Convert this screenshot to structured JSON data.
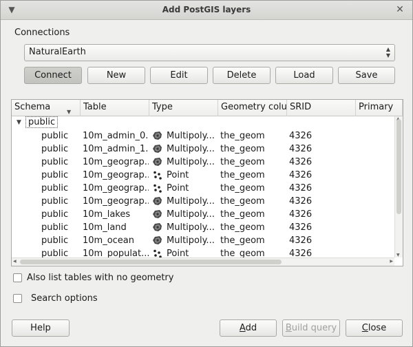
{
  "window": {
    "title": "Add PostGIS layers"
  },
  "connections": {
    "label": "Connections",
    "selected": "NaturalEarth",
    "buttons": {
      "connect": "Connect",
      "new": "New",
      "edit": "Edit",
      "delete": "Delete",
      "load": "Load",
      "save": "Save"
    }
  },
  "table": {
    "columns": [
      "Schema",
      "Table",
      "Type",
      "Geometry colur",
      "SRID",
      "Primary"
    ],
    "schema_node": "public",
    "rows": [
      {
        "schema": "public",
        "table": "10m_admin_0...",
        "type": "Multipoly...",
        "geom_icon": "polygon-icon",
        "geometry": "the_geom",
        "srid": "4326"
      },
      {
        "schema": "public",
        "table": "10m_admin_1...",
        "type": "Multipoly...",
        "geom_icon": "polygon-icon",
        "geometry": "the_geom",
        "srid": "4326"
      },
      {
        "schema": "public",
        "table": "10m_geograp...",
        "type": "Multipoly...",
        "geom_icon": "polygon-icon",
        "geometry": "the_geom",
        "srid": "4326"
      },
      {
        "schema": "public",
        "table": "10m_geograp...",
        "type": "Point",
        "geom_icon": "point-icon",
        "geometry": "the_geom",
        "srid": "4326"
      },
      {
        "schema": "public",
        "table": "10m_geograp...",
        "type": "Point",
        "geom_icon": "point-icon",
        "geometry": "the_geom",
        "srid": "4326"
      },
      {
        "schema": "public",
        "table": "10m_geograp...",
        "type": "Multipoly...",
        "geom_icon": "polygon-icon",
        "geometry": "the_geom",
        "srid": "4326"
      },
      {
        "schema": "public",
        "table": "10m_lakes",
        "type": "Multipoly...",
        "geom_icon": "polygon-icon",
        "geometry": "the_geom",
        "srid": "4326"
      },
      {
        "schema": "public",
        "table": "10m_land",
        "type": "Multipoly...",
        "geom_icon": "polygon-icon",
        "geometry": "the_geom",
        "srid": "4326"
      },
      {
        "schema": "public",
        "table": "10m_ocean",
        "type": "Multipoly...",
        "geom_icon": "polygon-icon",
        "geometry": "the_geom",
        "srid": "4326"
      },
      {
        "schema": "public",
        "table": "10m_populat...",
        "type": "Point",
        "geom_icon": "point-icon",
        "geometry": "the_geom",
        "srid": "4326"
      }
    ]
  },
  "options": {
    "list_no_geometry": "Also list tables with no geometry",
    "search_options": "Search options"
  },
  "footer": {
    "help": "Help",
    "add_prefix": "",
    "add_mnemonic": "A",
    "add_rest": "dd",
    "build_mnemonic": "B",
    "build_rest": "uild query",
    "close_mnemonic": "C",
    "close_rest": "lose"
  }
}
